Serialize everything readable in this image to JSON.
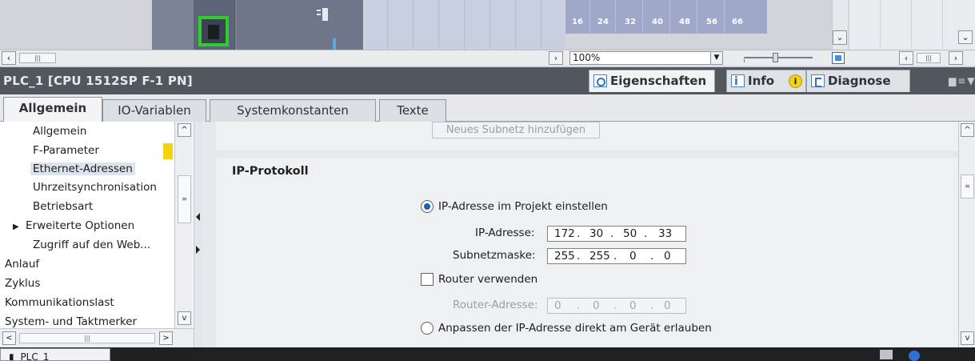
{
  "device_view": {
    "address_numbers": [
      "16",
      "24",
      "32",
      "40",
      "48",
      "56",
      "66"
    ],
    "zoom_level": "100%"
  },
  "inspector": {
    "title": "PLC_1 [CPU 1512SP F-1 PN]",
    "view_tabs": [
      {
        "label": "Eigenschaften",
        "icon": "properties-icon",
        "active": true
      },
      {
        "label": "Info",
        "icon": "info-icon",
        "active": false
      },
      {
        "label": "Diagnose",
        "icon": "diagnostics-icon",
        "active": false
      }
    ],
    "info_badge": "i",
    "tabs": [
      {
        "label": "Allgemein",
        "active": true
      },
      {
        "label": "IO-Variablen",
        "active": false
      },
      {
        "label": "Systemkonstanten",
        "active": false
      },
      {
        "label": "Texte",
        "active": false
      }
    ]
  },
  "nav": {
    "items": [
      {
        "label": "Allgemein",
        "level": 1,
        "selected": false
      },
      {
        "label": "F-Parameter",
        "level": 1,
        "selected": false
      },
      {
        "label": "Ethernet-Adressen",
        "level": 1,
        "selected": true
      },
      {
        "label": "Uhrzeitsynchronisation",
        "level": 1,
        "selected": false
      },
      {
        "label": "Betriebsart",
        "level": 1,
        "selected": false
      },
      {
        "label": "Erweiterte Optionen",
        "level": 1,
        "selected": false,
        "expandable": true
      },
      {
        "label": "Zugriff auf den Web...",
        "level": 1,
        "selected": false
      },
      {
        "label": "Anlauf",
        "level": 0,
        "selected": false
      },
      {
        "label": "Zyklus",
        "level": 0,
        "selected": false
      },
      {
        "label": "Kommunikationslast",
        "level": 0,
        "selected": false
      },
      {
        "label": "System- und Taktmerker",
        "level": 0,
        "selected": false
      }
    ]
  },
  "content": {
    "add_subnet_button": "Neues Subnetz hinzufügen",
    "ip_protocol": {
      "title": "IP-Protokoll",
      "option_set_in_project": "IP-Adresse im Projekt einstellen",
      "ip_label": "IP-Adresse:",
      "ip_octets": [
        "172",
        "30",
        "50",
        "33"
      ],
      "subnet_label": "Subnetzmaske:",
      "subnet_octets": [
        "255",
        "255",
        "0",
        "0"
      ],
      "use_router_label": "Router verwenden",
      "use_router_checked": false,
      "router_label": "Router-Adresse:",
      "router_octets": [
        "0",
        "0",
        "0",
        "0"
      ],
      "option_on_device": "Anpassen der IP-Adresse direkt am Gerät erlauben"
    }
  },
  "taskbar": {
    "item": "PLC_1"
  },
  "colors": {
    "title_bar": "#52575f",
    "selection_border": "#2ecc2e",
    "marker_yellow": "#f3d20f",
    "radio_blue": "#1a5fb4"
  }
}
